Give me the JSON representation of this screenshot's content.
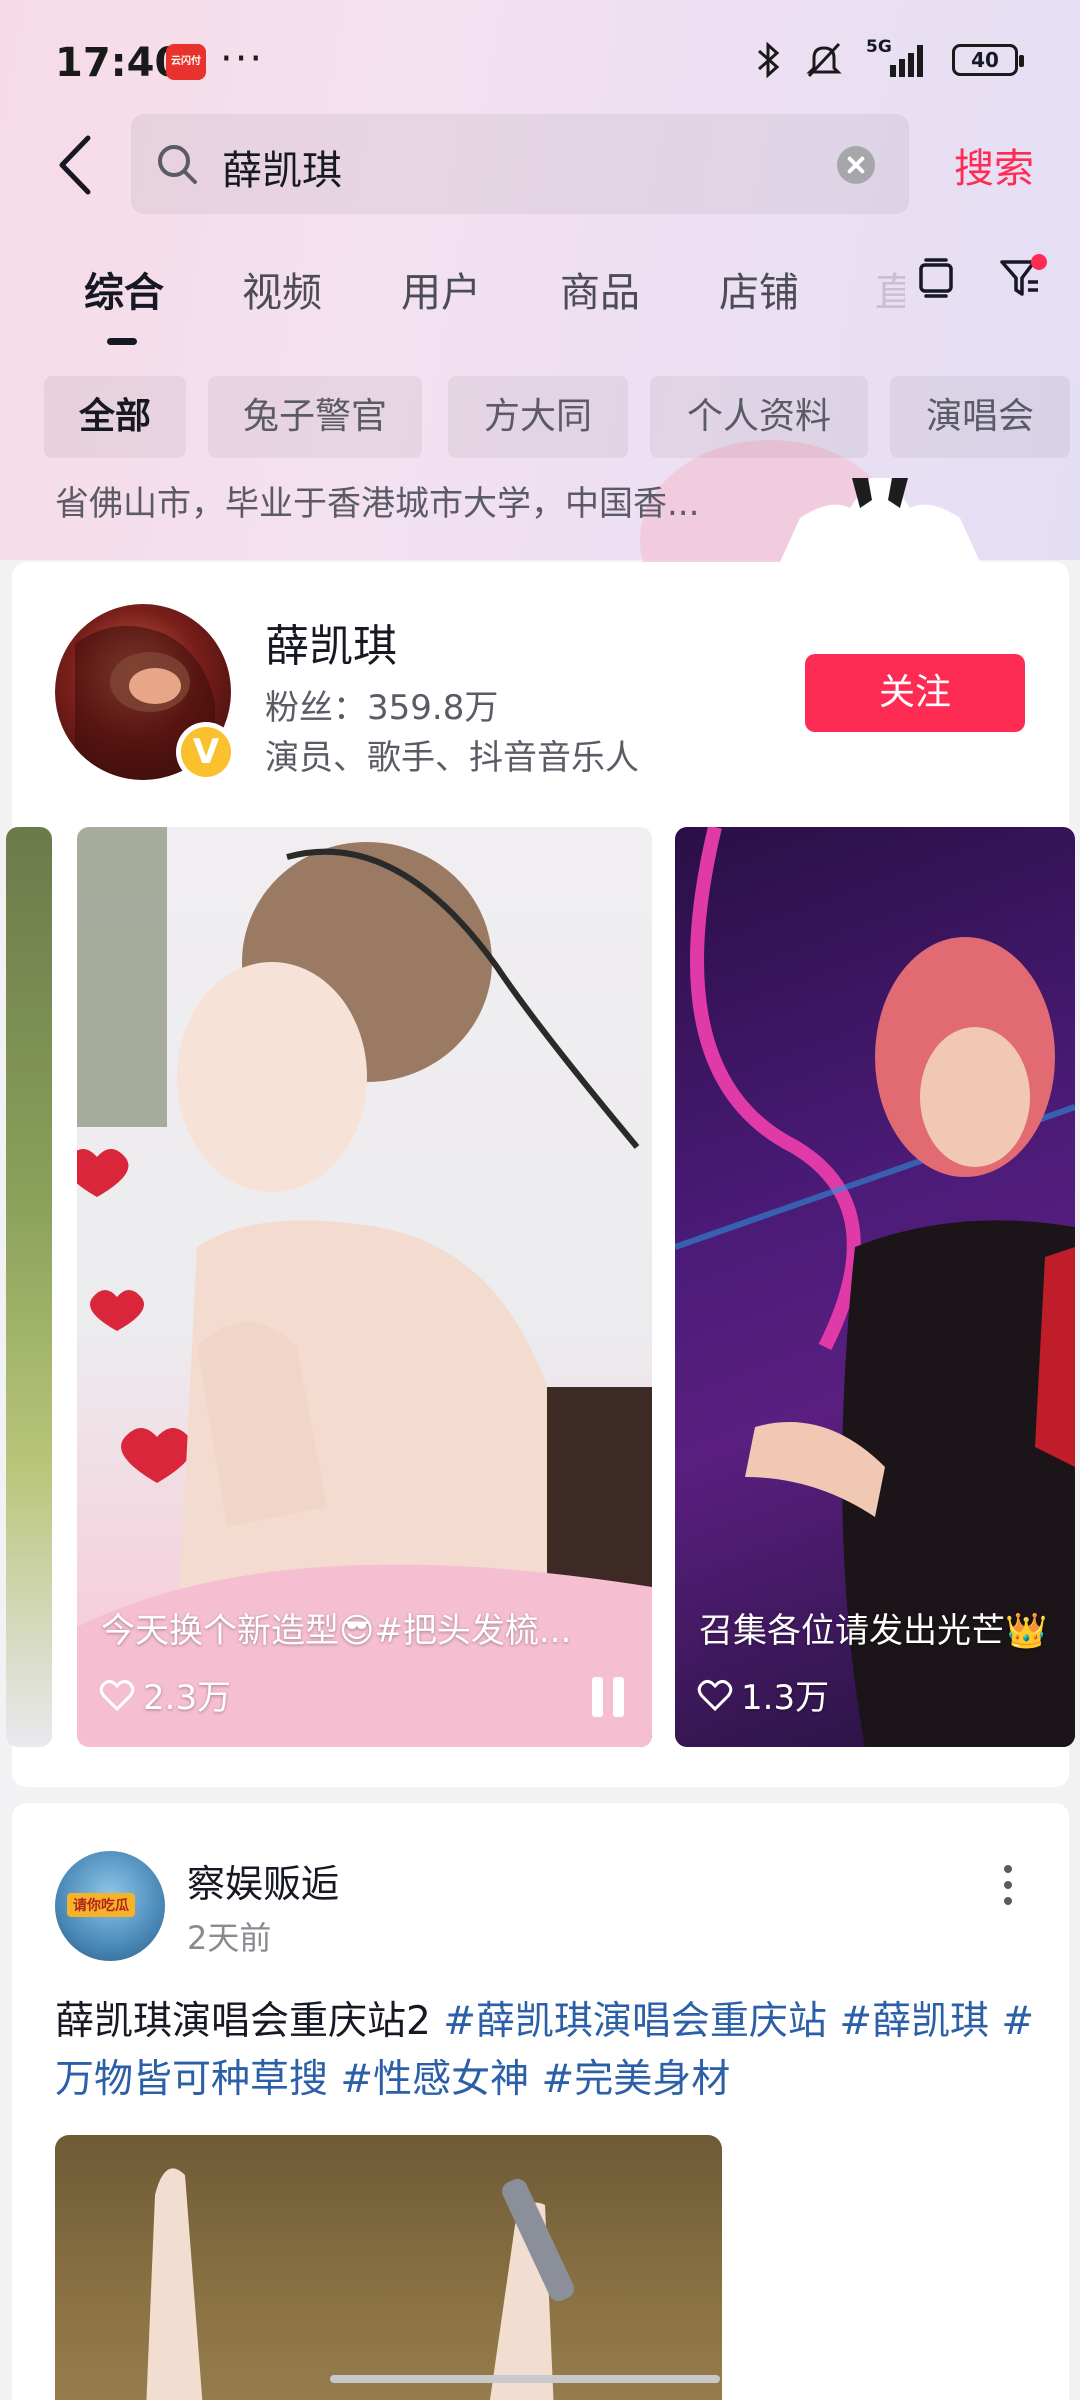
{
  "status_bar": {
    "time": "17:40",
    "app_badge": "云闪付",
    "more": "···",
    "network": "5G",
    "battery": "40"
  },
  "search": {
    "query": "薛凯琪",
    "button": "搜索"
  },
  "tabs": [
    "综合",
    "视频",
    "用户",
    "商品",
    "店铺",
    "直"
  ],
  "active_tab": 0,
  "chips": [
    "全部",
    "兔子警官",
    "方大同",
    "个人资料",
    "演唱会"
  ],
  "bio_peek": "省佛山市，毕业于香港城市大学，中国香...",
  "user_card": {
    "name": "薛凯琪",
    "fans": "粉丝：359.8万",
    "role": "演员、歌手、抖音音乐人",
    "follow": "关注",
    "verified_mark": "V",
    "videos": [
      {
        "caption": "今天换个新造型😎#把头发梳...",
        "likes": "2.3万",
        "playing": true
      },
      {
        "caption": "召集各位请发出光芒👑",
        "likes": "1.3万",
        "playing": false
      }
    ]
  },
  "post": {
    "author": "察娱贩逅",
    "time": "2天前",
    "avatar_tag": "请你吃瓜",
    "text_plain": "薛凯琪演唱会重庆站2 ",
    "hashtags": [
      "#薛凯琪演唱会重庆站",
      "#薛凯琪",
      "#万物皆可种草搜",
      "#性感女神",
      "#完美身材"
    ]
  },
  "colors": {
    "accent": "#fe2c55",
    "hashtag": "#2b5fa8",
    "verified": "#fbc02d"
  }
}
